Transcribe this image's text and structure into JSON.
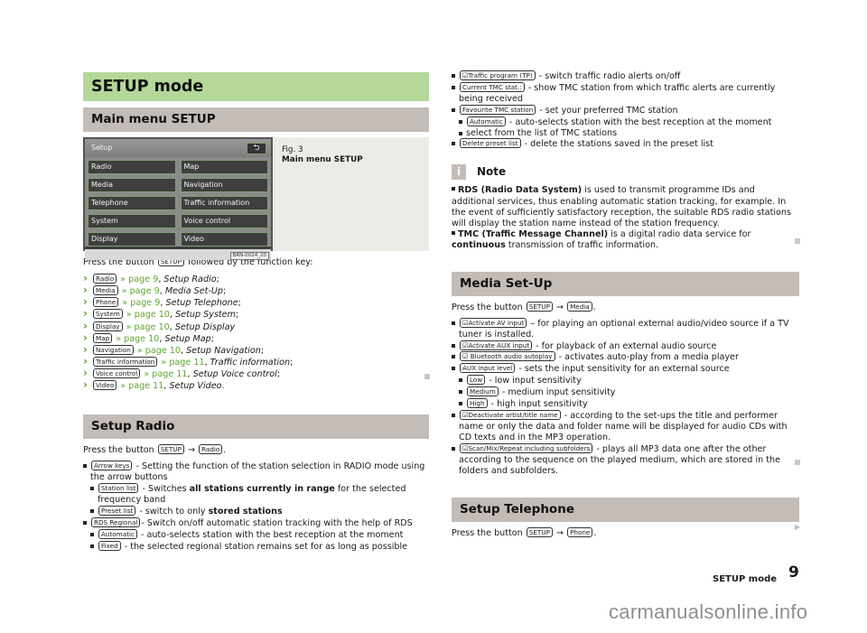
{
  "left": {
    "title": "SETUP mode",
    "subtitle": "Main menu SETUP",
    "figure": {
      "screen_title": "Setup",
      "back_icon": "back-arrow-icon",
      "keys": [
        "Radio",
        "Map",
        "Media",
        "Navigation",
        "Telephone",
        "Traffic information",
        "System",
        "Voice control",
        "Display",
        "Video"
      ],
      "code": "BRN-0024_20",
      "caption_label": "Fig. 3",
      "caption_title": "Main menu SETUP"
    },
    "intro": {
      "pre": "Press the button",
      "button": "SETUP",
      "post": "followed by the function key:"
    },
    "links": [
      {
        "button": "Radio",
        "page": "» page 9",
        "target": "Setup Radio",
        "end": ";"
      },
      {
        "button": "Media",
        "page": "» page 9",
        "target": "Media Set-Up",
        "end": ";"
      },
      {
        "button": "Phone",
        "page": "» page 9",
        "target": "Setup Telephone",
        "end": ";"
      },
      {
        "button": "System",
        "page": "» page 10",
        "target": "Setup System",
        "end": ";"
      },
      {
        "button": "Display",
        "page": "» page 10",
        "target": "Setup Display",
        "end": ""
      },
      {
        "button": "Map",
        "page": "» page 10",
        "target": "Setup Map",
        "end": ";"
      },
      {
        "button": "Navigation",
        "page": "» page 10",
        "target": "Setup Navigation",
        "end": ";"
      },
      {
        "button": "Traffic information",
        "page": "» page 11",
        "target": "Traffic information",
        "end": ";"
      },
      {
        "button": "Voice control",
        "page": "» page 11",
        "target": "Setup Voice control",
        "end": ";"
      },
      {
        "button": "Video",
        "page": "» page 11",
        "target": "Setup Video",
        "end": "."
      }
    ],
    "radio": {
      "title": "Setup Radio",
      "intro_pre": "Press the button",
      "btn1": "SETUP",
      "arrow": "→",
      "btn2": "Radio",
      "arrow_keys": {
        "button": "Arrow keys",
        "text": "- Setting the function of the station selection in RADIO mode using the arrow buttons"
      },
      "station_list": {
        "button": "Station list",
        "pre": "- Switches",
        "bold": "all stations currently in range",
        "post": "for the selected frequency band"
      },
      "preset_list": {
        "button": "Preset list",
        "pre": "- switch to only",
        "bold": "stored stations"
      },
      "rds_regional": {
        "button": "RDS Regional",
        "text": "- Switch on/off automatic station tracking with the help of RDS"
      },
      "automatic": {
        "button": "Automatic",
        "text": "- auto-selects station with the best reception at the moment"
      },
      "fixed": {
        "button": "Fixed",
        "text": "- the selected regional station remains set for as long as possible"
      }
    }
  },
  "right": {
    "tp": {
      "button": "☑Traffic program (TP)",
      "text": "- switch traffic radio alerts on/off"
    },
    "current_tmc": {
      "button": "Current TMC stat.:",
      "text": "- show TMC station from which traffic alerts are currently being received"
    },
    "fav_tmc": {
      "button": "Favourite TMC station",
      "text": "- set your preferred TMC station"
    },
    "fav_auto": {
      "button": "Automatic",
      "text": "- auto-selects station with the best reception at the moment"
    },
    "fav_select": "select from the list of TMC stations",
    "delete_preset": {
      "button": "Delete preset list",
      "text": "- delete the stations saved in the preset list"
    },
    "note": {
      "icon": "i",
      "title": "Note",
      "rds_bold": "RDS (Radio Data System)",
      "rds_text": "is used to transmit programme IDs and additional services, thus enabling automatic station tracking, for example. In the event of sufficiently satisfactory reception, the suitable RDS radio stations will display the station name instead of the station frequency.",
      "tmc_bold": "TMC (Traffic Message Channel)",
      "tmc_text": "is a digital radio data service for",
      "tmc_bold2": "continuous",
      "tmc_end": "transmission of traffic information."
    },
    "media": {
      "title": "Media Set-Up",
      "intro_pre": "Press the button",
      "btn1": "SETUP",
      "arrow": "→",
      "btn2": "Media",
      "items": [
        {
          "button": "☑Activate AV input",
          "text": "– for playing an optional external audio/video source if a TV tuner is installed."
        },
        {
          "button": "☑Activate AUX input",
          "text": "- for playback of an external audio source"
        },
        {
          "button": "☑ Bluetooth audio autoplay",
          "text": "- activates auto-play from a media player"
        },
        {
          "button": "AUX input level",
          "text": "- sets the input sensitivity for an external source"
        }
      ],
      "levels": [
        {
          "button": "Low",
          "text": "- low input sensitivity"
        },
        {
          "button": "Medium",
          "text": "- medium input sensitivity"
        },
        {
          "button": "High",
          "text": "- high input sensitivity"
        }
      ],
      "artist": {
        "button": "☑Deactivate artist/title name",
        "text": "- according to the set-ups the title and performer name or only the data and folder name will be displayed for audio CDs with CD texts and in the MP3 operation."
      },
      "scan": {
        "button": "☑Scan/Mix/Repeat including subfolders",
        "text": "- plays all MP3 data one after the other according to the sequence on the played medium, which are stored in the folders and subfolders."
      }
    },
    "telephone": {
      "title": "Setup Telephone",
      "intro_pre": "Press the button",
      "btn1": "SETUP",
      "arrow": "→",
      "btn2": "Phone",
      "end": "."
    }
  },
  "footer": {
    "section": "SETUP mode",
    "page": "9",
    "watermark": "carmanualsonline.info"
  },
  "colors": {
    "chapter_bg": "#b4d89a",
    "section_bg": "#c4bcb7",
    "link": "#5fa630",
    "figure_bg": "#ecebe6"
  }
}
